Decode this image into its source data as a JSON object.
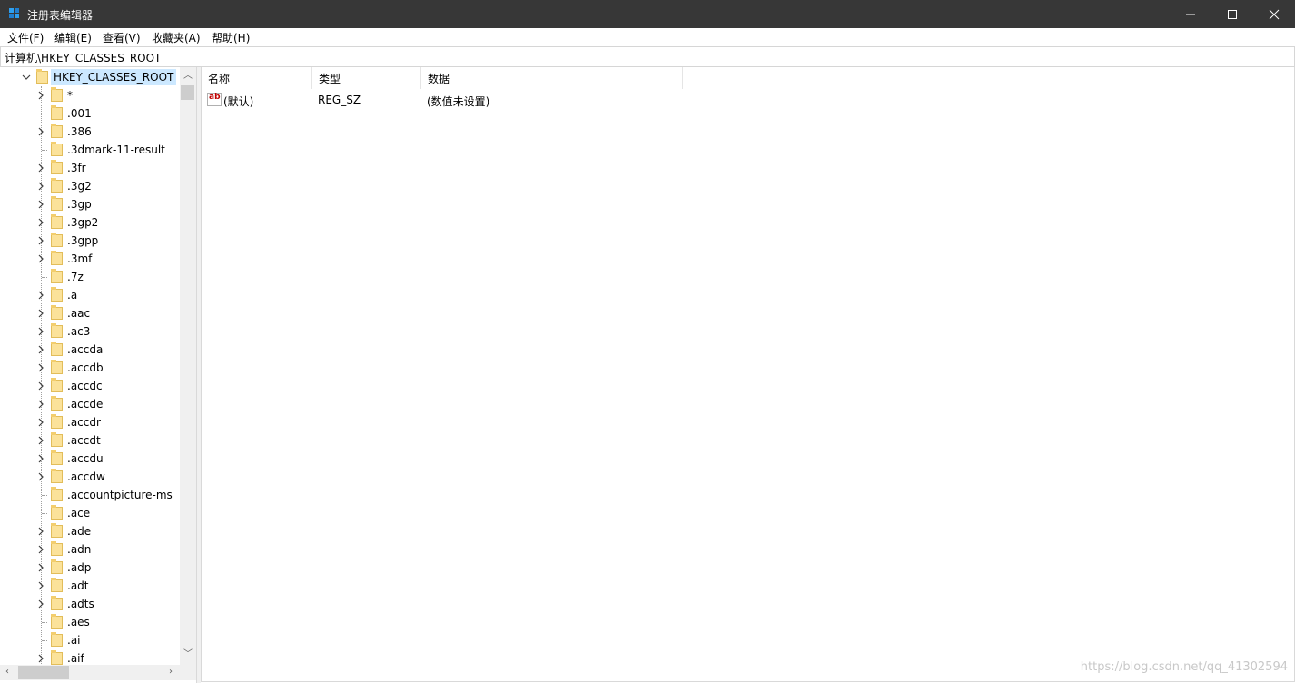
{
  "window": {
    "title": "注册表编辑器",
    "app_icon": "registry-editor-icon",
    "controls": [
      "minimize-icon",
      "maximize-icon",
      "close-icon"
    ]
  },
  "menu": [
    "文件(F)",
    "编辑(E)",
    "查看(V)",
    "收藏夹(A)",
    "帮助(H)"
  ],
  "address": {
    "path": "计算机\\HKEY_CLASSES_ROOT"
  },
  "tree": {
    "root": {
      "label": "HKEY_CLASSES_ROOT",
      "expanded": true,
      "selected": true
    },
    "items": [
      {
        "label": "*",
        "has_children": true
      },
      {
        "label": ".001",
        "has_children": false
      },
      {
        "label": ".386",
        "has_children": true
      },
      {
        "label": ".3dmark-11-result",
        "has_children": false
      },
      {
        "label": ".3fr",
        "has_children": true
      },
      {
        "label": ".3g2",
        "has_children": true
      },
      {
        "label": ".3gp",
        "has_children": true
      },
      {
        "label": ".3gp2",
        "has_children": true
      },
      {
        "label": ".3gpp",
        "has_children": true
      },
      {
        "label": ".3mf",
        "has_children": true
      },
      {
        "label": ".7z",
        "has_children": false
      },
      {
        "label": ".a",
        "has_children": true
      },
      {
        "label": ".aac",
        "has_children": true
      },
      {
        "label": ".ac3",
        "has_children": true
      },
      {
        "label": ".accda",
        "has_children": true
      },
      {
        "label": ".accdb",
        "has_children": true
      },
      {
        "label": ".accdc",
        "has_children": true
      },
      {
        "label": ".accde",
        "has_children": true
      },
      {
        "label": ".accdr",
        "has_children": true
      },
      {
        "label": ".accdt",
        "has_children": true
      },
      {
        "label": ".accdu",
        "has_children": true
      },
      {
        "label": ".accdw",
        "has_children": true
      },
      {
        "label": ".accountpicture-ms",
        "has_children": false
      },
      {
        "label": ".ace",
        "has_children": false
      },
      {
        "label": ".ade",
        "has_children": true
      },
      {
        "label": ".adn",
        "has_children": true
      },
      {
        "label": ".adp",
        "has_children": true
      },
      {
        "label": ".adt",
        "has_children": true
      },
      {
        "label": ".adts",
        "has_children": true
      },
      {
        "label": ".aes",
        "has_children": false
      },
      {
        "label": ".ai",
        "has_children": false
      },
      {
        "label": ".aif",
        "has_children": true
      }
    ]
  },
  "list": {
    "columns": [
      "名称",
      "类型",
      "数据"
    ],
    "rows": [
      {
        "name": "(默认)",
        "type": "REG_SZ",
        "data": "(数值未设置)",
        "icon": "string-value-icon",
        "icon_text": "ab"
      }
    ]
  },
  "watermark": "https://blog.csdn.net/qq_41302594",
  "colors": {
    "titlebar": "#373737",
    "selection": "#cce8ff",
    "folder": "#fbe29a"
  }
}
